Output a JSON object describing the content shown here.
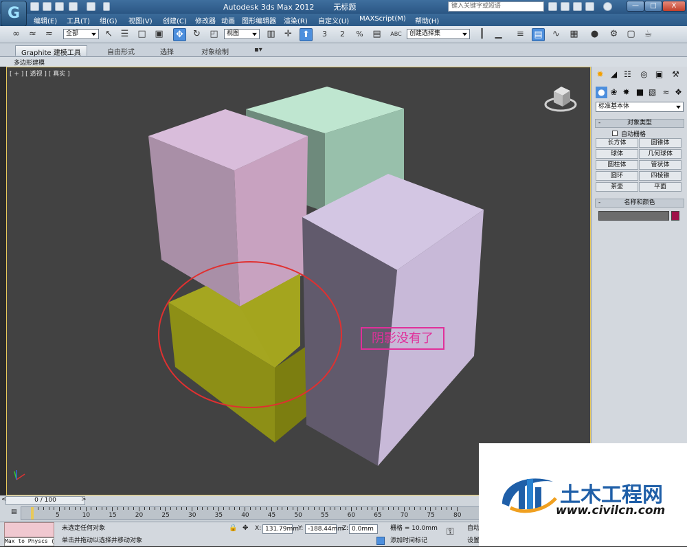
{
  "window": {
    "app_title": "Autodesk 3ds Max  2012",
    "doc_title": "无标题",
    "help_search_placeholder": "键入关键字或短语",
    "minimize": "—",
    "restore": "□",
    "close": "X"
  },
  "menu": [
    "编辑(E)",
    "工具(T)",
    "组(G)",
    "视图(V)",
    "创建(C)",
    "修改器",
    "动画",
    "图形编辑器",
    "渲染(R)",
    "自定义(U)",
    "MAXScript(M)",
    "帮助(H)"
  ],
  "toolbar": {
    "selection_filter": "全部",
    "ref_coord": "视图",
    "named_selection": "创建选择集",
    "snap_3": "3",
    "snap_2_5": "2",
    "snap_percent": "%",
    "abc": "ABC"
  },
  "ribbon": {
    "tabs": [
      "Graphite 建模工具",
      "自由形式",
      "选择",
      "对象绘制"
    ],
    "subtab": "多边形建模"
  },
  "viewport": {
    "label": "[ + ] [ 透视 ] [ 真实 ]",
    "annotation": "阴影没有了",
    "colors": {
      "pink_box": "#c9a3c4",
      "green_box": "#a8d3bd",
      "lavender_box": "#c4b6d6",
      "olive_block": "#a0a220",
      "annotation": "#e0309a",
      "circle": "#e03030"
    }
  },
  "command_panel": {
    "category": "标准基本体",
    "object_type_title": "对象类型",
    "auto_grid": "自动栅格",
    "buttons": [
      [
        "长方体",
        "圆锥体"
      ],
      [
        "球体",
        "几何球体"
      ],
      [
        "圆柱体",
        "管状体"
      ],
      [
        "圆环",
        "四棱锥"
      ],
      [
        "茶壶",
        "平面"
      ]
    ],
    "name_color_title": "名称和颜色",
    "object_color": "#a0124a"
  },
  "timeline": {
    "slider": "0 / 100",
    "prev": "<",
    "next": ">",
    "ticks": [
      "5",
      "10",
      "15",
      "20",
      "25",
      "30",
      "35",
      "40",
      "45",
      "50",
      "55",
      "60",
      "65",
      "70",
      "75",
      "80"
    ]
  },
  "status": {
    "listener": "Max to Physcs (",
    "selection_status": "未选定任何对象",
    "prompt": "单击并拖动以选择并移动对象",
    "x_label": "X:",
    "x": "131.79mm",
    "y_label": "Y:",
    "y": "-188.44mm",
    "z_label": "Z:",
    "z": "0.0mm",
    "grid": "栅格 = 10.0mm",
    "add_time_tag": "添加时间标记",
    "auto_key": "自动",
    "set_key": "设置"
  },
  "watermark": {
    "brand": "土木工程网",
    "url": "www.civilcn.com"
  }
}
